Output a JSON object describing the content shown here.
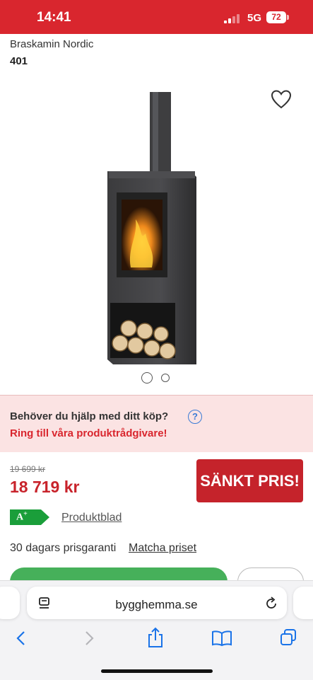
{
  "status_bar": {
    "time": "14:41",
    "network": "5G",
    "battery": "72"
  },
  "product": {
    "brand": "Braskamin Nordic",
    "model": "401",
    "image_count": 2,
    "active_image": 1
  },
  "help": {
    "question": "Behöver du hjälp med ditt köp?",
    "icon_label": "?",
    "link": "Ring till våra produktrådgivare!"
  },
  "pricing": {
    "old_price": "19 699 kr",
    "price": "18 719 kr",
    "badge": "SÄNKT PRIS!"
  },
  "energy": {
    "class": "A",
    "plus": "+",
    "link": "Produktblad"
  },
  "guarantee": {
    "text": "30 dagars prisgaranti",
    "link": "Matcha priset"
  },
  "browser": {
    "url": "bygghemma.se"
  },
  "colors": {
    "brand_red": "#d9262e",
    "buy_green": "#46b05a",
    "energy_green": "#1a9e3a"
  }
}
